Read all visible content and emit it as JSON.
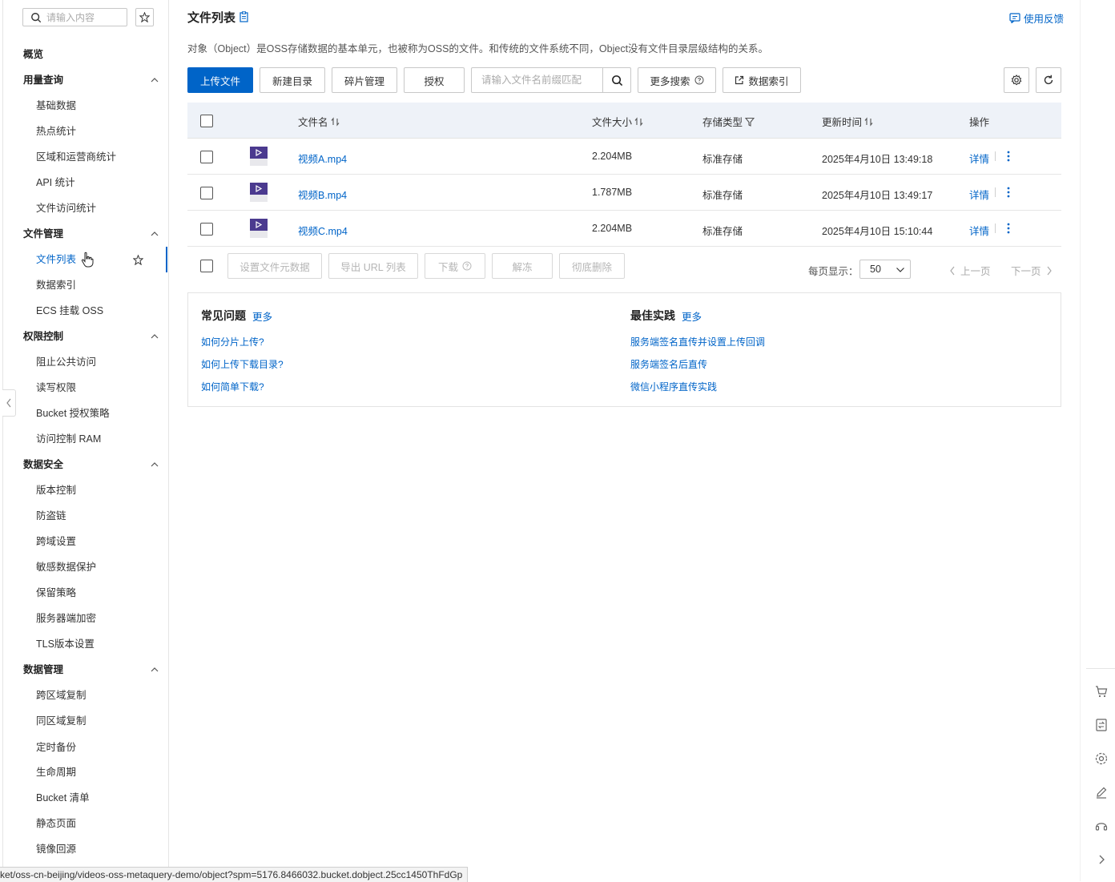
{
  "sidebar": {
    "search_placeholder": "请输入内容",
    "overview": "概览",
    "groups": [
      {
        "label": "用量查询",
        "items": [
          "基础数据",
          "热点统计",
          "区域和运营商统计",
          "API 统计",
          "文件访问统计"
        ]
      },
      {
        "label": "文件管理",
        "items": [
          "文件列表",
          "数据索引",
          "ECS 挂载 OSS"
        ]
      },
      {
        "label": "权限控制",
        "items": [
          "阻止公共访问",
          "读写权限",
          "Bucket 授权策略",
          "访问控制 RAM"
        ]
      },
      {
        "label": "数据安全",
        "items": [
          "版本控制",
          "防盗链",
          "跨域设置",
          "敏感数据保护",
          "保留策略",
          "服务器端加密",
          "TLS版本设置"
        ]
      },
      {
        "label": "数据管理",
        "items": [
          "跨区域复制",
          "同区域复制",
          "定时备份",
          "生命周期",
          "Bucket 清单",
          "静态页面",
          "镜像回源"
        ]
      }
    ],
    "active_item": "文件列表"
  },
  "header": {
    "title": "文件列表",
    "feedback": "使用反馈",
    "description": "对象（Object）是OSS存储数据的基本单元，也被称为OSS的文件。和传统的文件系统不同，Object没有文件目录层级结构的关系。"
  },
  "toolbar": {
    "upload": "上传文件",
    "new_dir": "新建目录",
    "fragments": "碎片管理",
    "authorize": "授权",
    "search_placeholder": "请输入文件名前缀匹配",
    "more_search": "更多搜索",
    "data_index": "数据索引"
  },
  "table": {
    "columns": {
      "name": "文件名",
      "size": "文件大小",
      "storage": "存储类型",
      "updated": "更新时间",
      "ops": "操作"
    },
    "rows": [
      {
        "name": "视频A.mp4",
        "size": "2.204MB",
        "storage": "标准存储",
        "updated": "2025年4月10日 13:49:18",
        "detail": "详情"
      },
      {
        "name": "视频B.mp4",
        "size": "1.787MB",
        "storage": "标准存储",
        "updated": "2025年4月10日 13:49:17",
        "detail": "详情"
      },
      {
        "name": "视频C.mp4",
        "size": "2.204MB",
        "storage": "标准存储",
        "updated": "2025年4月10日 15:10:44",
        "detail": "详情"
      }
    ]
  },
  "batch": {
    "set_meta": "设置文件元数据",
    "export_url": "导出 URL 列表",
    "download": "下载",
    "unfreeze": "解冻",
    "delete": "彻底删除"
  },
  "pagination": {
    "page_size_label": "每页显示：",
    "page_size": "50",
    "prev": "上一页",
    "next": "下一页"
  },
  "faq": {
    "title": "常见问题",
    "more": "更多",
    "links": [
      "如何分片上传?",
      "如何上传下载目录?",
      "如何简单下载?"
    ]
  },
  "best": {
    "title": "最佳实践",
    "more": "更多",
    "links": [
      "服务端签名直传并设置上传回调",
      "服务端签名后直传",
      "微信小程序直传实践"
    ]
  },
  "status_url": "ket/oss-cn-beijing/videos-oss-metaquery-demo/object?spm=5176.8466032.bucket.dobject.25cc1450ThFdGp",
  "colors": {
    "accent": "#0064c8",
    "header_bg": "#eef2f8",
    "file_icon": "#4b3a8f"
  },
  "right_rail_icons": [
    "cart-icon",
    "transfer-icon",
    "settings-icon",
    "edit-icon",
    "headset-icon",
    "chevron-right-icon"
  ]
}
